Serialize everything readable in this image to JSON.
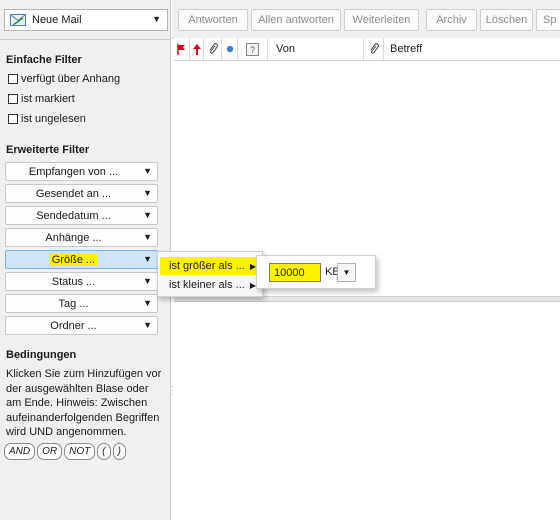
{
  "new_mail": {
    "label": "Neue Mail",
    "icon": "new-mail-icon"
  },
  "simple_filters": {
    "title": "Einfache Filter",
    "items": [
      {
        "label": "verfügt über Anhang",
        "checked": false
      },
      {
        "label": "ist markiert",
        "checked": false
      },
      {
        "label": "ist ungelesen",
        "checked": false
      }
    ]
  },
  "advanced_filters": {
    "title": "Erweiterte Filter",
    "buttons": [
      {
        "label": "Empfangen von ..."
      },
      {
        "label": "Gesendet an ..."
      },
      {
        "label": "Sendedatum ..."
      },
      {
        "label": "Anhänge ..."
      },
      {
        "label": "Größe ...",
        "active": true
      },
      {
        "label": "Status ..."
      },
      {
        "label": "Tag ..."
      },
      {
        "label": "Ordner ..."
      }
    ]
  },
  "conditions": {
    "title": "Bedingungen",
    "text": "Klicken Sie zum Hinzufügen vor der ausgewählten Blase oder am Ende. Hinweis: Zwischen aufeinanderfolgenden Begriffen wird UND angenommen.",
    "operators": [
      "AND",
      "OR",
      "NOT",
      "(",
      ")"
    ]
  },
  "toolbar": {
    "buttons": [
      "Antworten",
      "Allen antworten",
      "Weiterleiten",
      "Archiv",
      "Löschen",
      "Sp"
    ]
  },
  "list_header": {
    "icons": [
      "flag-icon",
      "priority-icon",
      "attachment-icon",
      "unread-dot-icon",
      "junk-icon"
    ],
    "from": "Von",
    "subject": "Betreff"
  },
  "size_menu": {
    "items": [
      {
        "label": "ist größer als ...",
        "highlighted": true
      },
      {
        "label": "ist kleiner als ...",
        "highlighted": false
      }
    ]
  },
  "size_input": {
    "value": "10000",
    "unit": "KB"
  },
  "colors": {
    "highlight": "#fff200",
    "active_button": "#cde4f7",
    "flag": "#d0021b"
  }
}
